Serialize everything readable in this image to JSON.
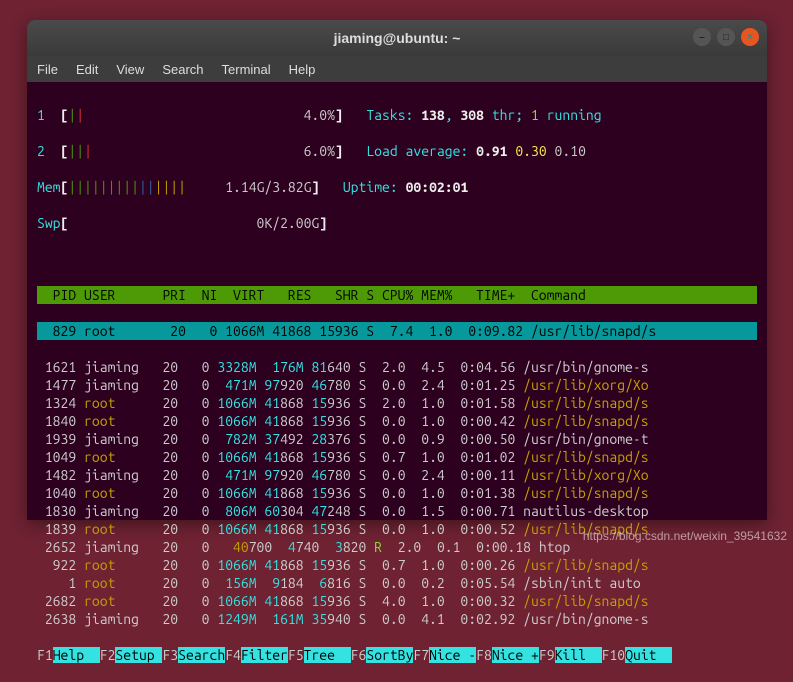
{
  "window": {
    "title": "jiaming@ubuntu: ~"
  },
  "menu": [
    "File",
    "Edit",
    "View",
    "Search",
    "Terminal",
    "Help"
  ],
  "meters": {
    "cpu1": {
      "label": "1",
      "bars": "||",
      "pct": "4.0%"
    },
    "cpu2": {
      "label": "2",
      "bars": "|||",
      "pct": "6.0%"
    },
    "mem": {
      "label": "Mem",
      "bars": "|||||||||||||||",
      "usage": "1.14G/3.82G"
    },
    "swp": {
      "label": "Swp",
      "usage": "0K/2.00G"
    }
  },
  "info": {
    "tasks_label": "Tasks: ",
    "tasks_n": "138",
    "tasks_thr": "308",
    "tasks_thr_label": " thr; ",
    "tasks_run": "1",
    "tasks_run_label": " running",
    "load_label": "Load average: ",
    "l1": "0.91",
    "l2": "0.30",
    "l3": "0.10",
    "uptime_label": "Uptime: ",
    "uptime": "00:02:01"
  },
  "columns": "  PID USER      PRI  NI  VIRT   RES   SHR S CPU% MEM%   TIME+  Command          ",
  "sel_row": "  829 root       20   0 1066M 41868 15936 S  7.4  1.0  0:09.82 /usr/lib/snapd/s",
  "rows": [
    {
      "p": " 1621",
      "u": " jiaming  ",
      "pri": " 20 ",
      "ni": "  0",
      "v": " 3328M",
      "r": "  176M",
      "g": " 81",
      "sh": "640 S  2.0  4.5  0:04.56 /usr/bin/gnome-s"
    },
    {
      "p": " 1477",
      "u": " jiaming  ",
      "pri": " 20 ",
      "ni": "  0",
      "v": "  471M",
      "r": " 97",
      "r2": "920",
      "g": " 46",
      "sh": "780 S  0.0  2.4  0:01.25 ",
      "cmd": "/usr/lib/xorg/Xo"
    },
    {
      "p": " 1324",
      "u": " root     ",
      "root": true,
      "pri": " 20 ",
      "ni": "  0",
      "v": " 1066M",
      "r": " 41",
      "r2": "868",
      "g": " 15",
      "sh": "936 S  2.0  1.0  0:01.58 ",
      "cmd": "/usr/lib/snapd/s"
    },
    {
      "p": " 1840",
      "u": " root     ",
      "root": true,
      "pri": " 20 ",
      "ni": "  0",
      "v": " 1066M",
      "r": " 41",
      "r2": "868",
      "g": " 15",
      "sh": "936 S  0.0  1.0  0:00.42 ",
      "cmd": "/usr/lib/snapd/s"
    },
    {
      "p": " 1939",
      "u": " jiaming  ",
      "pri": " 20 ",
      "ni": "  0",
      "v": "  782M",
      "r": " 37",
      "r2": "492",
      "g": " 28",
      "sh": "376 S  0.0  0.9  0:00.50 /usr/bin/gnome-t"
    },
    {
      "p": " 1049",
      "u": " root     ",
      "root": true,
      "pri": " 20 ",
      "ni": "  0",
      "v": " 1066M",
      "r": " 41",
      "r2": "868",
      "g": " 15",
      "sh": "936 S  0.7  1.0  0:01.02 ",
      "cmd": "/usr/lib/snapd/s"
    },
    {
      "p": " 1482",
      "u": " jiaming  ",
      "pri": " 20 ",
      "ni": "  0",
      "v": "  471M",
      "r": " 97",
      "r2": "920",
      "g": " 46",
      "sh": "780 S  0.0  2.4  0:00.11 ",
      "cmd": "/usr/lib/xorg/Xo"
    },
    {
      "p": " 1040",
      "u": " root     ",
      "root": true,
      "pri": " 20 ",
      "ni": "  0",
      "v": " 1066M",
      "r": " 41",
      "r2": "868",
      "g": " 15",
      "sh": "936 S  0.0  1.0  0:01.38 ",
      "cmd": "/usr/lib/snapd/s"
    },
    {
      "p": " 1830",
      "u": " jiaming  ",
      "pri": " 20 ",
      "ni": "  0",
      "v": "  806M",
      "r": " 60",
      "r2": "304",
      "g": " 47",
      "sh": "248 S  0.0  1.5  0:00.71 nautilus-desktop"
    },
    {
      "p": " 1839",
      "u": " root     ",
      "root": true,
      "pri": " 20 ",
      "ni": "  0",
      "v": " 1066M",
      "r": " 41",
      "r2": "868",
      "g": " 15",
      "sh": "936 S  0.0  1.0  0:00.52 ",
      "cmd": "/usr/lib/snapd/s"
    },
    {
      "p": " 2652",
      "u": " jiaming  ",
      "pri": " 20 ",
      "ni": "  0",
      "v": "   40",
      "v2": "700",
      "r": "  4",
      "r2": "740",
      "g": "  3",
      "sh": "820 ",
      "st": "R",
      "rest": "  2.0  0.1  0:00.18 htop"
    },
    {
      "p": "  922",
      "u": " root     ",
      "root": true,
      "pri": " 20 ",
      "ni": "  0",
      "v": " 1066M",
      "r": " 41",
      "r2": "868",
      "g": " 15",
      "sh": "936 S  0.7  1.0  0:00.26 ",
      "cmd": "/usr/lib/snapd/s"
    },
    {
      "p": "    1",
      "u": " root     ",
      "root": true,
      "pri": " 20 ",
      "ni": "  0",
      "v": "  156M",
      "r": "  9",
      "r2": "184",
      "g": "  6",
      "sh": "816 S  0.0  0.2  0:05.54 /sbin/init auto"
    },
    {
      "p": " 2682",
      "u": " root     ",
      "root": true,
      "pri": " 20 ",
      "ni": "  0",
      "v": " 1066M",
      "r": " 41",
      "r2": "868",
      "g": " 15",
      "sh": "936 S  4.0  1.0  0:00.32 ",
      "cmd": "/usr/lib/snapd/s"
    },
    {
      "p": " 2638",
      "u": " jiaming  ",
      "pri": " 20 ",
      "ni": "  0",
      "v": " 1249M",
      "r": "  161M",
      "g": " 35",
      "sh": "940 S  0.0  4.1  0:02.92 /usr/bin/gnome-s"
    }
  ],
  "footer": [
    {
      "k": "F1",
      "a": "Help  "
    },
    {
      "k": "F2",
      "a": "Setup "
    },
    {
      "k": "F3",
      "a": "Search"
    },
    {
      "k": "F4",
      "a": "Filter"
    },
    {
      "k": "F5",
      "a": "Tree  "
    },
    {
      "k": "F6",
      "a": "SortBy"
    },
    {
      "k": "F7",
      "a": "Nice -"
    },
    {
      "k": "F8",
      "a": "Nice +"
    },
    {
      "k": "F9",
      "a": "Kill  "
    },
    {
      "k": "F10",
      "a": "Quit  "
    }
  ],
  "watermark": "https://blog.csdn.net/weixin_39541632"
}
